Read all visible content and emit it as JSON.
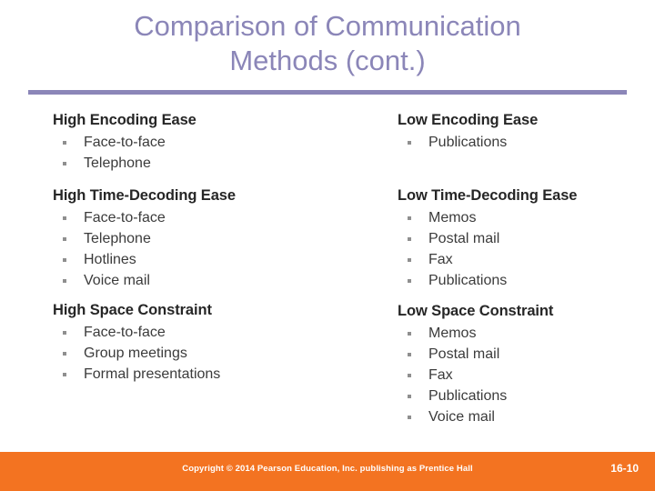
{
  "slide": {
    "title": "Comparison of Communication\nMethods (cont.)",
    "title_color": "#8b86b8",
    "rule_color": "#8b86b8",
    "background_color": "#ffffff"
  },
  "columns": {
    "left": [
      {
        "heading": "High Encoding Ease",
        "items": [
          "Face-to-face",
          "Telephone"
        ]
      },
      {
        "heading": "High Time-Decoding Ease",
        "items": [
          "Face-to-face",
          "Telephone",
          "Hotlines",
          "Voice mail"
        ]
      },
      {
        "heading": "High Space Constraint",
        "items": [
          "Face-to-face",
          "Group meetings",
          "Formal presentations"
        ]
      }
    ],
    "right": [
      {
        "heading": "Low Encoding Ease",
        "items": [
          "Publications"
        ]
      },
      {
        "heading": "Low Time-Decoding Ease",
        "items": [
          "Memos",
          "Postal mail",
          "Fax",
          "Publications"
        ]
      },
      {
        "heading": "Low Space Constraint",
        "items": [
          "Memos",
          "Postal mail",
          "Fax",
          "Publications",
          "Voice mail"
        ]
      }
    ]
  },
  "footer": {
    "copyright": "Copyright © 2014 Pearson Education, Inc. publishing as Prentice Hall",
    "slide_number": "16-10",
    "bar_color": "#f37321",
    "text_color": "#ffffff"
  }
}
